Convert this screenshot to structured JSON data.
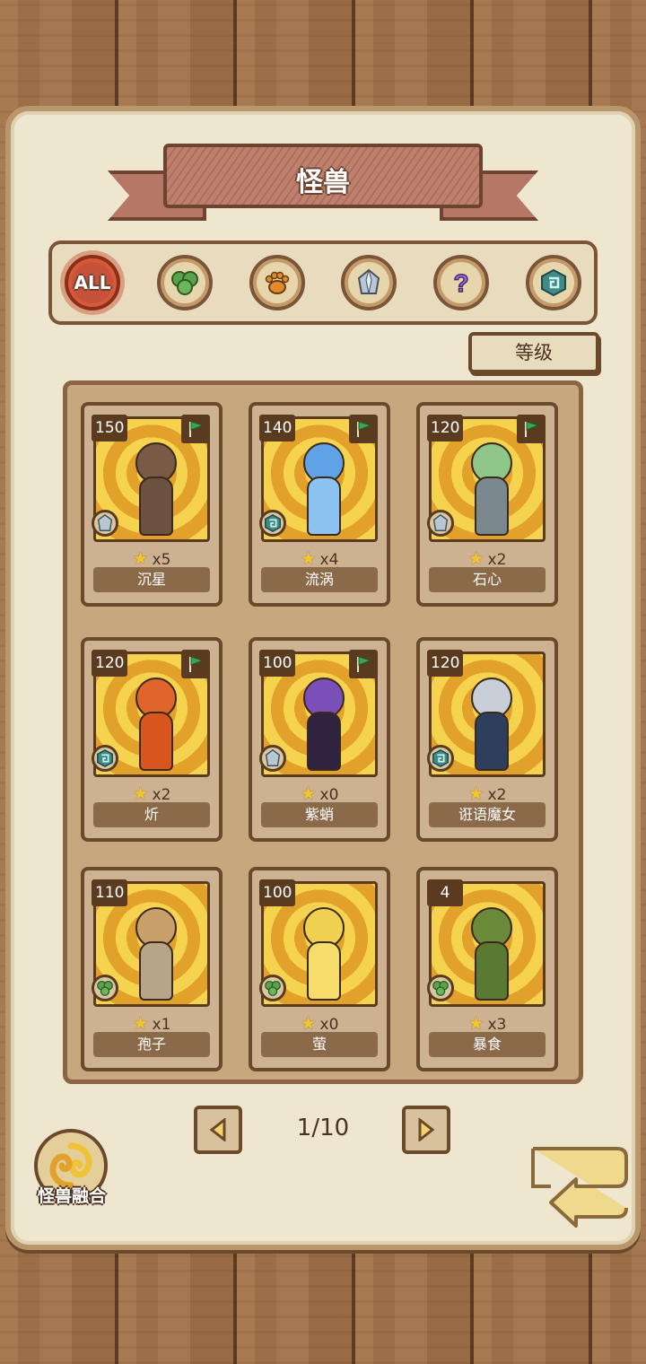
{
  "header": {
    "title": "怪兽"
  },
  "filters": [
    {
      "id": "all",
      "label": "ALL",
      "icon": "all-icon",
      "active": true
    },
    {
      "id": "plant",
      "icon": "leaf-icon",
      "active": false
    },
    {
      "id": "beast",
      "icon": "paw-icon",
      "active": false
    },
    {
      "id": "mineral",
      "icon": "crystal-icon",
      "active": false
    },
    {
      "id": "mystery",
      "icon": "question-icon",
      "active": false
    },
    {
      "id": "element",
      "icon": "spiral-icon",
      "active": false
    }
  ],
  "sort": {
    "label": "等级"
  },
  "monsters": [
    {
      "level": "150",
      "stars": "x5",
      "name": "沉星",
      "type_icon": "crystal-icon",
      "flag": true
    },
    {
      "level": "140",
      "stars": "x4",
      "name": "流涡",
      "type_icon": "spiral-icon",
      "flag": true
    },
    {
      "level": "120",
      "stars": "x2",
      "name": "石心",
      "type_icon": "crystal-icon",
      "flag": true
    },
    {
      "level": "120",
      "stars": "x2",
      "name": "炘",
      "type_icon": "spiral-icon",
      "flag": true
    },
    {
      "level": "100",
      "stars": "x0",
      "name": "紫蛸",
      "type_icon": "crystal-icon",
      "flag": true
    },
    {
      "level": "120",
      "stars": "x2",
      "name": "诳语魔女",
      "type_icon": "spiral-icon",
      "flag": false
    },
    {
      "level": "110",
      "stars": "x1",
      "name": "孢子",
      "type_icon": "leaf-icon",
      "flag": false
    },
    {
      "level": "100",
      "stars": "x0",
      "name": "萤",
      "type_icon": "leaf-icon",
      "flag": false
    },
    {
      "level": "4",
      "stars": "x3",
      "name": "暴食",
      "type_icon": "leaf-icon",
      "flag": false
    }
  ],
  "pagination": {
    "text": "1/10"
  },
  "fusion": {
    "label": "怪兽融合"
  },
  "colors": {
    "accent_red": "#d45a3a",
    "wood": "#9c6f48",
    "parchment": "#efe6cf",
    "card_gold": "#f6d34e",
    "flag_green": "#3aa84a"
  }
}
